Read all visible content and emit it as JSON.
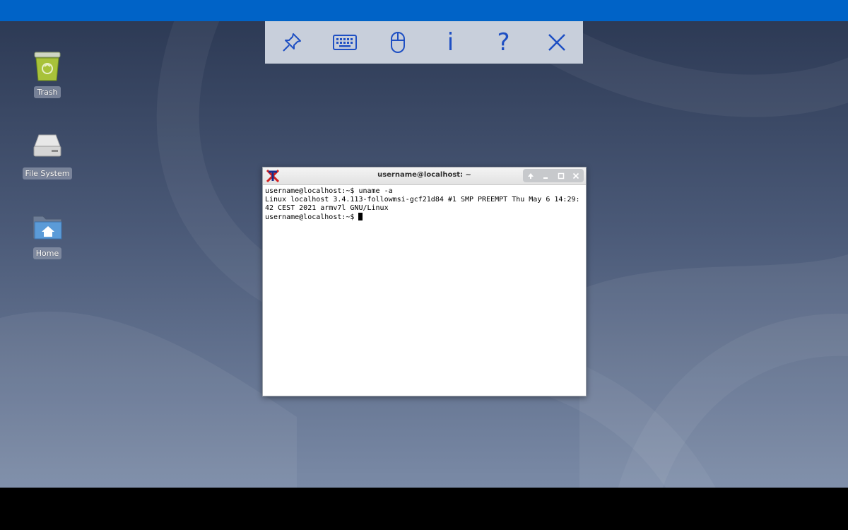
{
  "toolbar": {
    "buttons": [
      {
        "name": "pin",
        "icon": "pin-icon"
      },
      {
        "name": "keyboard",
        "icon": "keyboard-icon"
      },
      {
        "name": "mouse",
        "icon": "mouse-icon"
      },
      {
        "name": "info",
        "icon": "info-icon",
        "text": "i"
      },
      {
        "name": "help",
        "icon": "help-icon",
        "text": "?"
      },
      {
        "name": "close",
        "icon": "close-icon"
      }
    ],
    "accent_color": "#1e4fc3",
    "background_color": "#c8cfdb"
  },
  "desktop": {
    "icons": [
      {
        "label": "Trash",
        "icon": "trash-icon"
      },
      {
        "label": "File System",
        "icon": "drive-icon"
      },
      {
        "label": "Home",
        "icon": "home-folder-icon"
      }
    ]
  },
  "terminal": {
    "title": "username@localhost: ~",
    "lines": [
      "username@localhost:~$ uname -a",
      "Linux localhost 3.4.113-followmsi-gcf21d84 #1 SMP PREEMPT Thu May 6 14:29:42 CEST 2021 armv7l GNU/Linux",
      "username@localhost:~$ "
    ],
    "controls": [
      "up-arrow-icon",
      "minimize-icon",
      "maximize-icon",
      "close-icon"
    ]
  },
  "colors": {
    "topbar": "#0063c7",
    "desktop_top": "#2d3a55",
    "desktop_bottom": "#7a8aa6"
  }
}
